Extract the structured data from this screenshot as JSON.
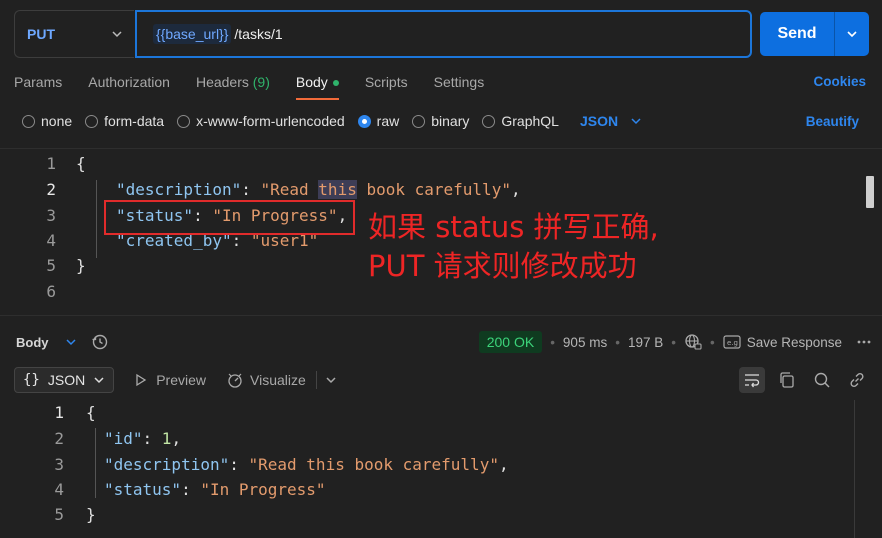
{
  "request": {
    "method": "PUT",
    "url_variable": "{{base_url}}",
    "url_path": "/tasks/1",
    "send_label": "Send"
  },
  "tabs": [
    {
      "label": "Params"
    },
    {
      "label": "Authorization"
    },
    {
      "label": "Headers",
      "badge": "(9)"
    },
    {
      "label": "Body",
      "active": true
    },
    {
      "label": "Scripts"
    },
    {
      "label": "Settings"
    }
  ],
  "cookies_label": "Cookies",
  "body_types": [
    "none",
    "form-data",
    "x-www-form-urlencoded",
    "raw",
    "binary",
    "GraphQL"
  ],
  "body_type_selected": "raw",
  "format_label": "JSON",
  "beautify_label": "Beautify",
  "request_body": {
    "line_numbers": [
      "1",
      "2",
      "3",
      "4",
      "5",
      "6"
    ],
    "open_brace": "{",
    "close_brace": "}",
    "key_description": "\"description\"",
    "val_description_1": "\"Read ",
    "val_description_hl": "this",
    "val_description_2": " book carefully\"",
    "key_status": "\"status\"",
    "val_status": "\"In Progress\"",
    "key_created_by": "\"created_by\"",
    "val_created_by": "\"user1\""
  },
  "annotation": {
    "line1": "如果 status 拼写正确,",
    "line2": "PUT 请求则修改成功"
  },
  "response": {
    "section_label": "Body",
    "status": "200 OK",
    "time": "905 ms",
    "size": "197 B",
    "save_label": "Save Response",
    "format_label": "JSON",
    "preview_label": "Preview",
    "visualize_label": "Visualize",
    "line_numbers": [
      "1",
      "2",
      "3",
      "4",
      "5"
    ],
    "open_brace": "{",
    "close_brace": "}",
    "key_id": "\"id\"",
    "val_id": "1",
    "key_description": "\"description\"",
    "val_description": "\"Read this book carefully\"",
    "key_status": "\"status\"",
    "val_status": "\"In Progress\""
  },
  "colors": {
    "accent": "#0d6fe0",
    "tab_indicator": "#f26b3a",
    "status_ok": "#3cd37a",
    "annotation": "#ee2525"
  }
}
